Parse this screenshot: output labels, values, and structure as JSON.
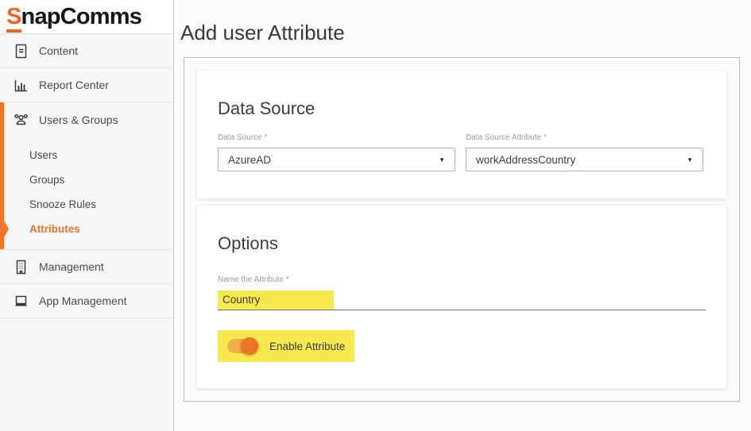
{
  "brand": {
    "logo_s": "S",
    "logo_rest": "napComms",
    "orange": "#f26522"
  },
  "colors": {
    "accent_orange": "#ee7524",
    "highlight_yellow": "#f7e94d",
    "toggle_track": "#f4ad4c",
    "toggle_knob": "#ee7522"
  },
  "sidebar": {
    "top_items": [
      {
        "label": "Content",
        "icon": "document-icon"
      },
      {
        "label": "Report Center",
        "icon": "bar-chart-icon"
      }
    ],
    "users_groups": {
      "label": "Users & Groups",
      "icon": "users-icon"
    },
    "sub_items": [
      {
        "label": "Users",
        "active": false
      },
      {
        "label": "Groups",
        "active": false
      },
      {
        "label": "Snooze Rules",
        "active": false
      },
      {
        "label": "Attributes",
        "active": true
      }
    ],
    "bottom_items": [
      {
        "label": "Management",
        "icon": "building-icon"
      },
      {
        "label": "App Management",
        "icon": "laptop-icon"
      }
    ]
  },
  "main": {
    "page_title": "Add user Attribute",
    "data_source_section": {
      "title": "Data Source",
      "fields": [
        {
          "label": "Data Source *",
          "value": "AzureAD",
          "arrow": "▼"
        },
        {
          "label": "Data Source Attribute *",
          "value": "workAddressCountry",
          "arrow": "▼"
        }
      ]
    },
    "options_section": {
      "title": "Options",
      "name_label": "Name the Attribute *",
      "name_value": "Country",
      "toggle_label": "Enable Attribute",
      "toggle_state": "on"
    }
  }
}
